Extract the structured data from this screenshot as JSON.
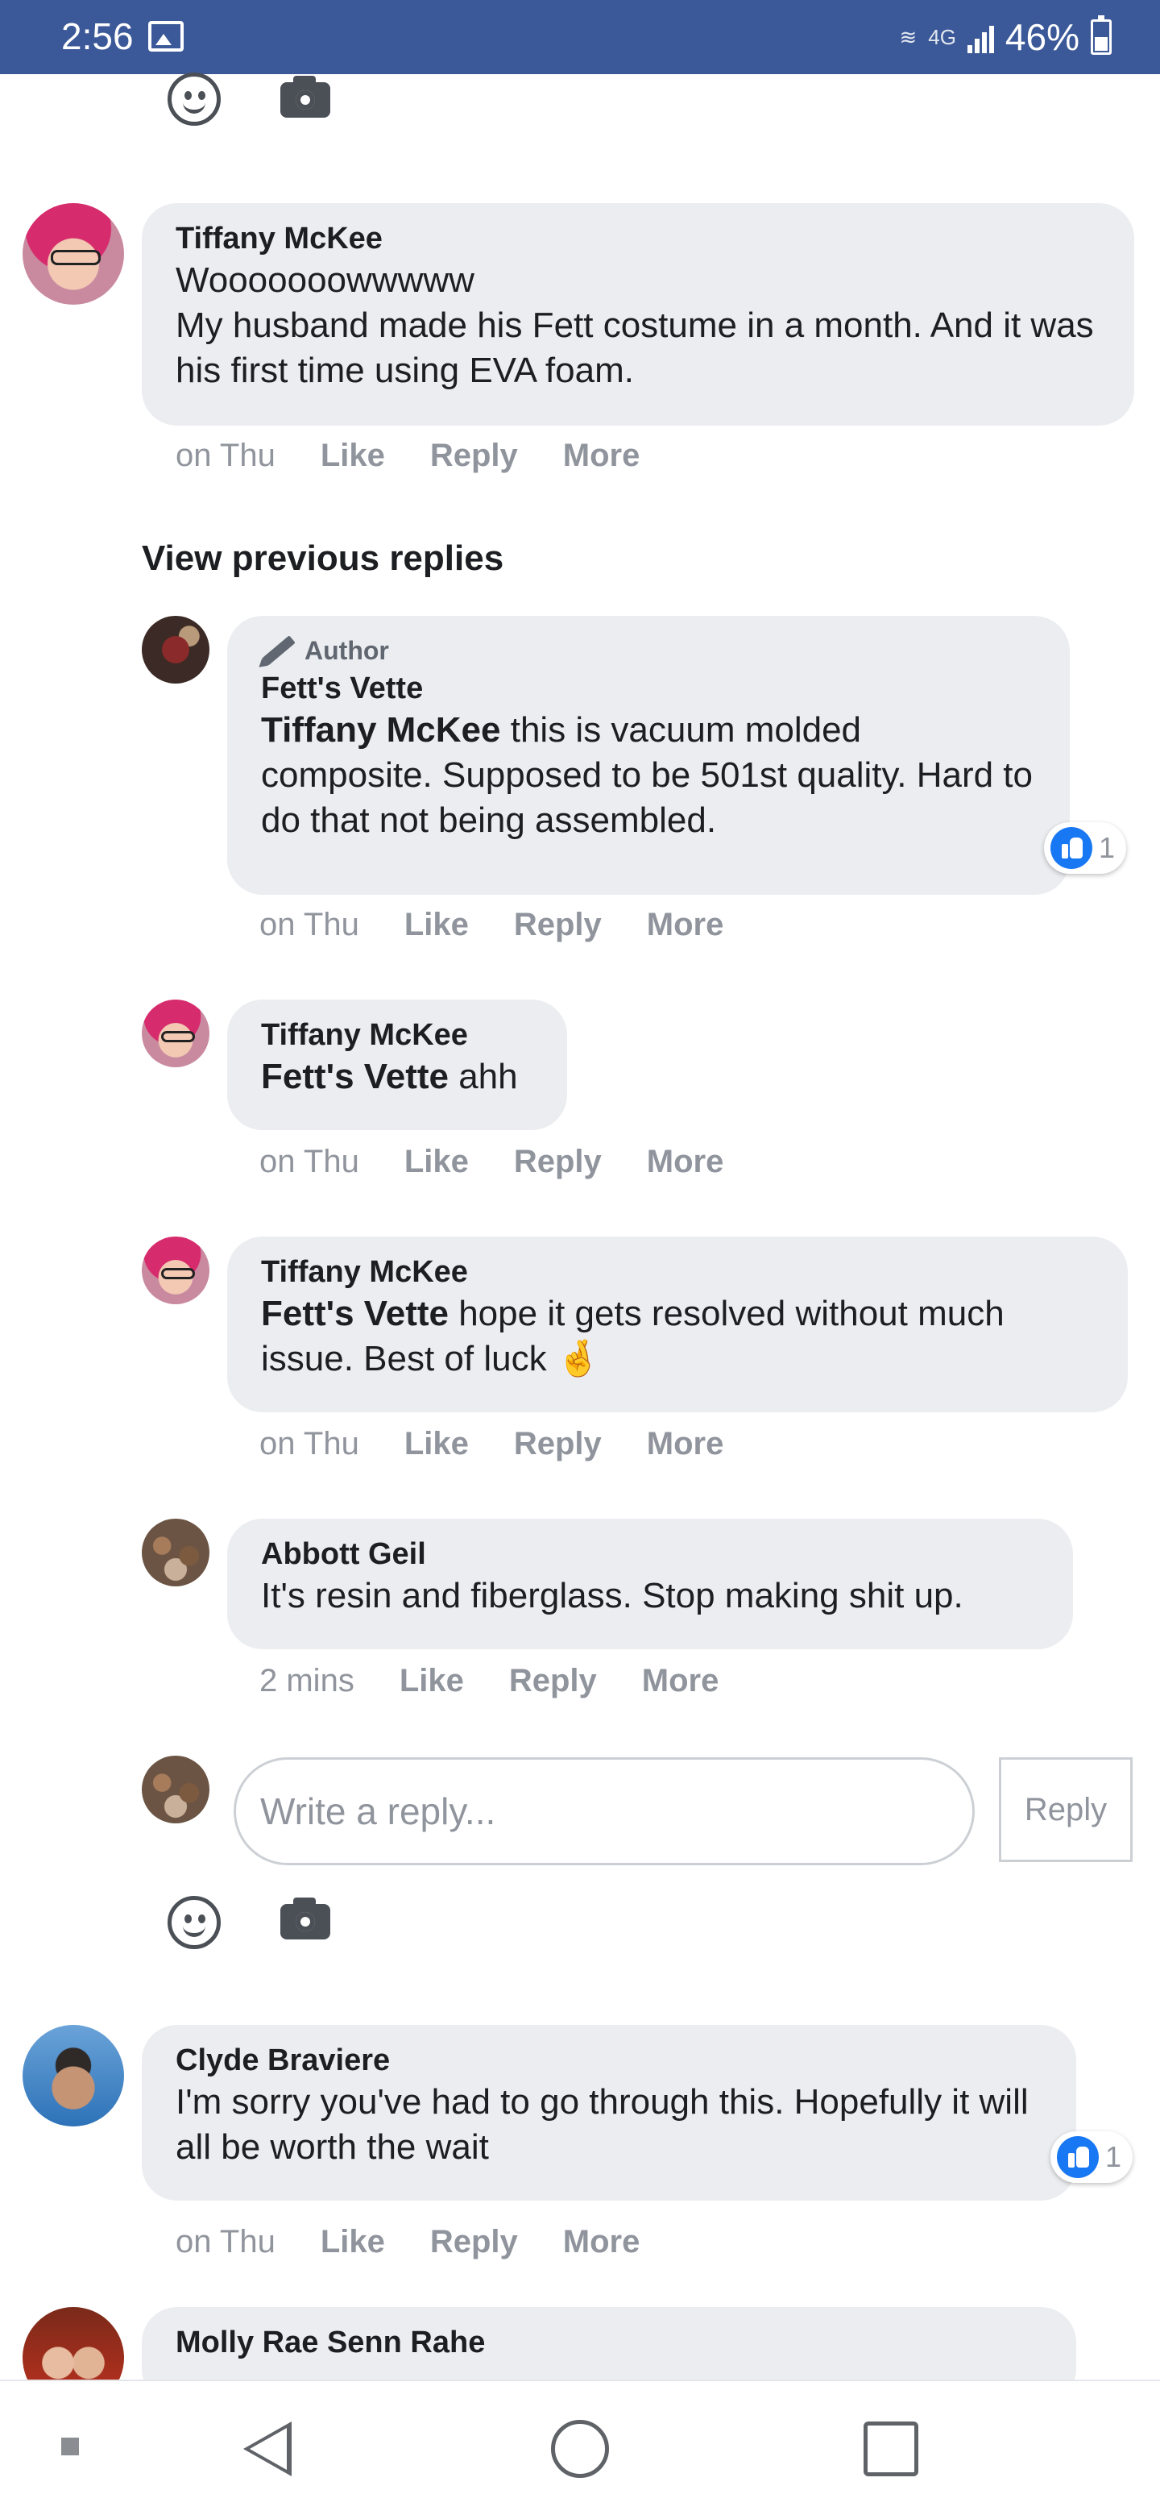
{
  "status_bar": {
    "time": "2:56",
    "network": "4G",
    "battery": "46%"
  },
  "comments": [
    {
      "name": "Tiffany McKee",
      "text": "Wooooooowwwww\nMy husband made his Fett costume in a month. And it was his first time using EVA foam.",
      "time": "on Thu"
    }
  ],
  "view_previous": "View previous replies",
  "replies": [
    {
      "author_tag": "Author",
      "name": "Fett's Vette",
      "mention": "Tiffany McKee",
      "text": " this is vacuum molded composite. Supposed to be 501st quality. Hard to do that not being assembled.",
      "time": "on Thu",
      "reactions": "1"
    },
    {
      "name": "Tiffany McKee",
      "mention": "Fett's Vette",
      "text": " ahh",
      "time": "on Thu"
    },
    {
      "name": "Tiffany McKee",
      "mention": "Fett's Vette",
      "text": " hope it gets resolved without much issue. Best of luck 🤞",
      "time": "on Thu"
    },
    {
      "name": "Abbott Geil",
      "text": "It's resin and fiberglass. Stop making shit up.",
      "time": "2 mins"
    }
  ],
  "actions": {
    "like": "Like",
    "reply": "Reply",
    "more": "More"
  },
  "reply_box": {
    "placeholder": "Write a reply...",
    "button": "Reply"
  },
  "later_comments": [
    {
      "name": "Clyde Braviere",
      "text": "I'm sorry you've had to go through this. Hopefully it will all be worth the wait",
      "time": "on Thu",
      "reactions": "1"
    },
    {
      "name": "Molly Rae Senn Rahe"
    }
  ],
  "icons": {
    "emoji": "smile-icon",
    "camera": "camera-icon",
    "like": "like-icon",
    "author": "pencil-icon"
  },
  "colors": {
    "status_bar": "#3b5998",
    "bubble": "#ebedf0",
    "meta_text": "#90949c",
    "like_blue": "#1877f2"
  }
}
